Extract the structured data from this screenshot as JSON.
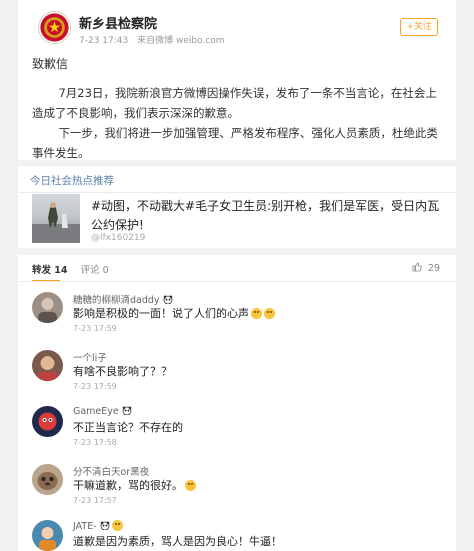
{
  "post": {
    "author": "新乡县检察院",
    "time": "7-23 17:43",
    "source": "来自微博 weibo.com",
    "follow_label": "+关注",
    "title": "致歉信",
    "paragraph1": "7月23日，我院新浪官方微博因操作失误，发布了一条不当言论，在社会上造成了不良影响，我们表示深深的歉意。",
    "paragraph2": "下一步，我们将进一步加强管理、严格发布程序、强化人员素质，杜绝此类事件发生。"
  },
  "recommend": {
    "heading": "今日社会热点推荐",
    "title": "#动图，不动戳大#毛子女卫生员:别开枪，我们是军医，受日内瓦公约保护!",
    "source": "@lfx160219"
  },
  "comments_section": {
    "tabs": [
      {
        "label": "转发 14"
      },
      {
        "label": "评论 0"
      }
    ],
    "likes_count": "29",
    "items": [
      {
        "name": "糖糖的柳柳滴daddy",
        "text": "影响是积极的一面！说了人们的心声",
        "time": "7-23 17:59",
        "avatar_color": "#9c8f86",
        "emoji_count": 2
      },
      {
        "name": "一个li子",
        "text": "有啥不良影响了？？",
        "time": "7-23 17:59",
        "avatar_color": "#7a5a4c",
        "emoji_count": 0
      },
      {
        "name": "GameEye",
        "text": "不正当言论？不存在的",
        "time": "7-23 17:58",
        "avatar_color": "#1f2a4a",
        "emoji_count": 0
      },
      {
        "name": "分不清白天or黑夜",
        "text": "干嘛道歉，骂的很好。",
        "time": "7-23 17:57",
        "avatar_color": "#8a6a50",
        "emoji_count": 1
      },
      {
        "name": "JATE-",
        "text": "道歉是因为素质，骂人是因为良心！牛逼！",
        "time": "7-23 17:57",
        "avatar_color": "#4a8ab0",
        "emoji_count": 0
      }
    ]
  },
  "colors": {
    "accent": "#f5a623",
    "link": "#5a7fa8"
  }
}
